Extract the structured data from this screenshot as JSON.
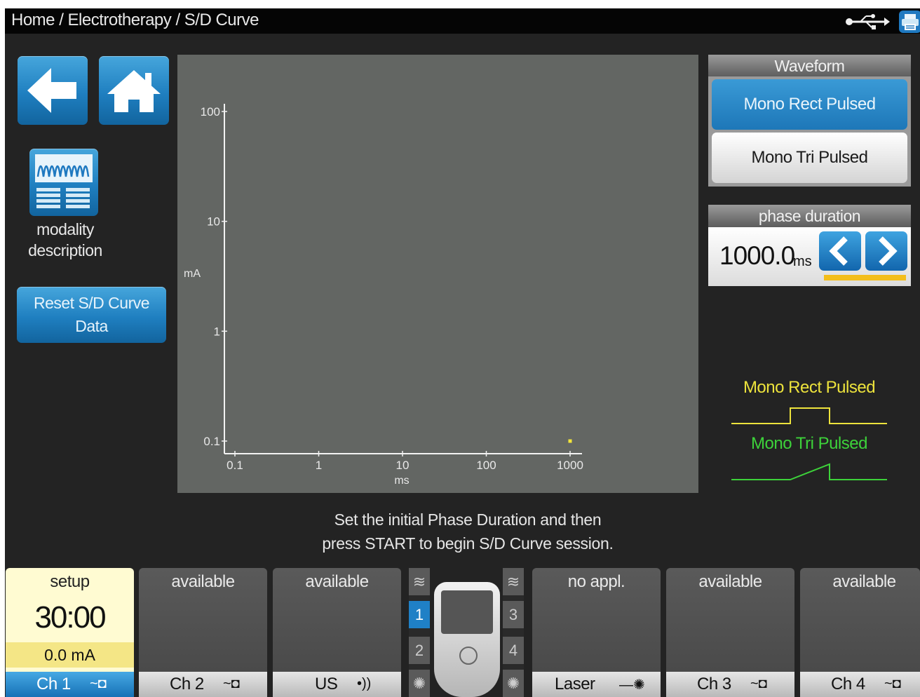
{
  "breadcrumb": "Home / Electrotherapy / S/D Curve",
  "left": {
    "modality_label_line1": "modality",
    "modality_label_line2": "description",
    "reset_label": "Reset S/D Curve Data"
  },
  "chart_data": {
    "type": "scatter",
    "xlabel": "ms",
    "ylabel": "mA",
    "x_scale": "log",
    "y_scale": "log",
    "x_ticks": [
      "0.1",
      "1",
      "10",
      "100",
      "1000"
    ],
    "y_ticks": [
      "100",
      "10",
      "1",
      "0.1"
    ],
    "xlim": [
      0.1,
      1000
    ],
    "ylim": [
      0.1,
      100
    ],
    "points": [
      {
        "x": 1000,
        "y": 0.1
      }
    ],
    "point_color": "#f3e63a"
  },
  "waveform": {
    "header": "Waveform",
    "options": [
      "Mono Rect Pulsed",
      "Mono Tri Pulsed"
    ],
    "selected": "Mono Rect Pulsed"
  },
  "phase_duration": {
    "header": "phase duration",
    "value": "1000.0",
    "unit": "ms"
  },
  "legend": {
    "rect_label": "Mono Rect Pulsed",
    "rect_color": "#ede33c",
    "tri_label": "Mono Tri Pulsed",
    "tri_color": "#3dd23a"
  },
  "instruction": {
    "line1": "Set the initial Phase Duration and then",
    "line2": "press START to begin S/D Curve session."
  },
  "channels": {
    "ch1": {
      "status": "setup",
      "timer": "30:00",
      "current": "0.0 mA",
      "label": "Ch 1",
      "icon": "electrode-icon"
    },
    "ch2": {
      "status": "available",
      "label": "Ch 2",
      "icon": "electrode-icon"
    },
    "us": {
      "status": "available",
      "label": "US",
      "icon": "ultrasound-icon"
    },
    "laser": {
      "status": "no appl.",
      "label": "Laser",
      "icon": "laser-icon"
    },
    "ch3": {
      "status": "available",
      "label": "Ch 3",
      "icon": "electrode-icon"
    },
    "ch4": {
      "status": "available",
      "label": "Ch 4",
      "icon": "electrode-icon"
    }
  },
  "device": {
    "left_slots": [
      "1",
      "2"
    ],
    "right_slots": [
      "3",
      "4"
    ],
    "active_slot": "1"
  },
  "icons": {
    "ultrasound_glyph": "•))",
    "laser_glyph": "—✺",
    "electrode_glyph": "~◘"
  }
}
